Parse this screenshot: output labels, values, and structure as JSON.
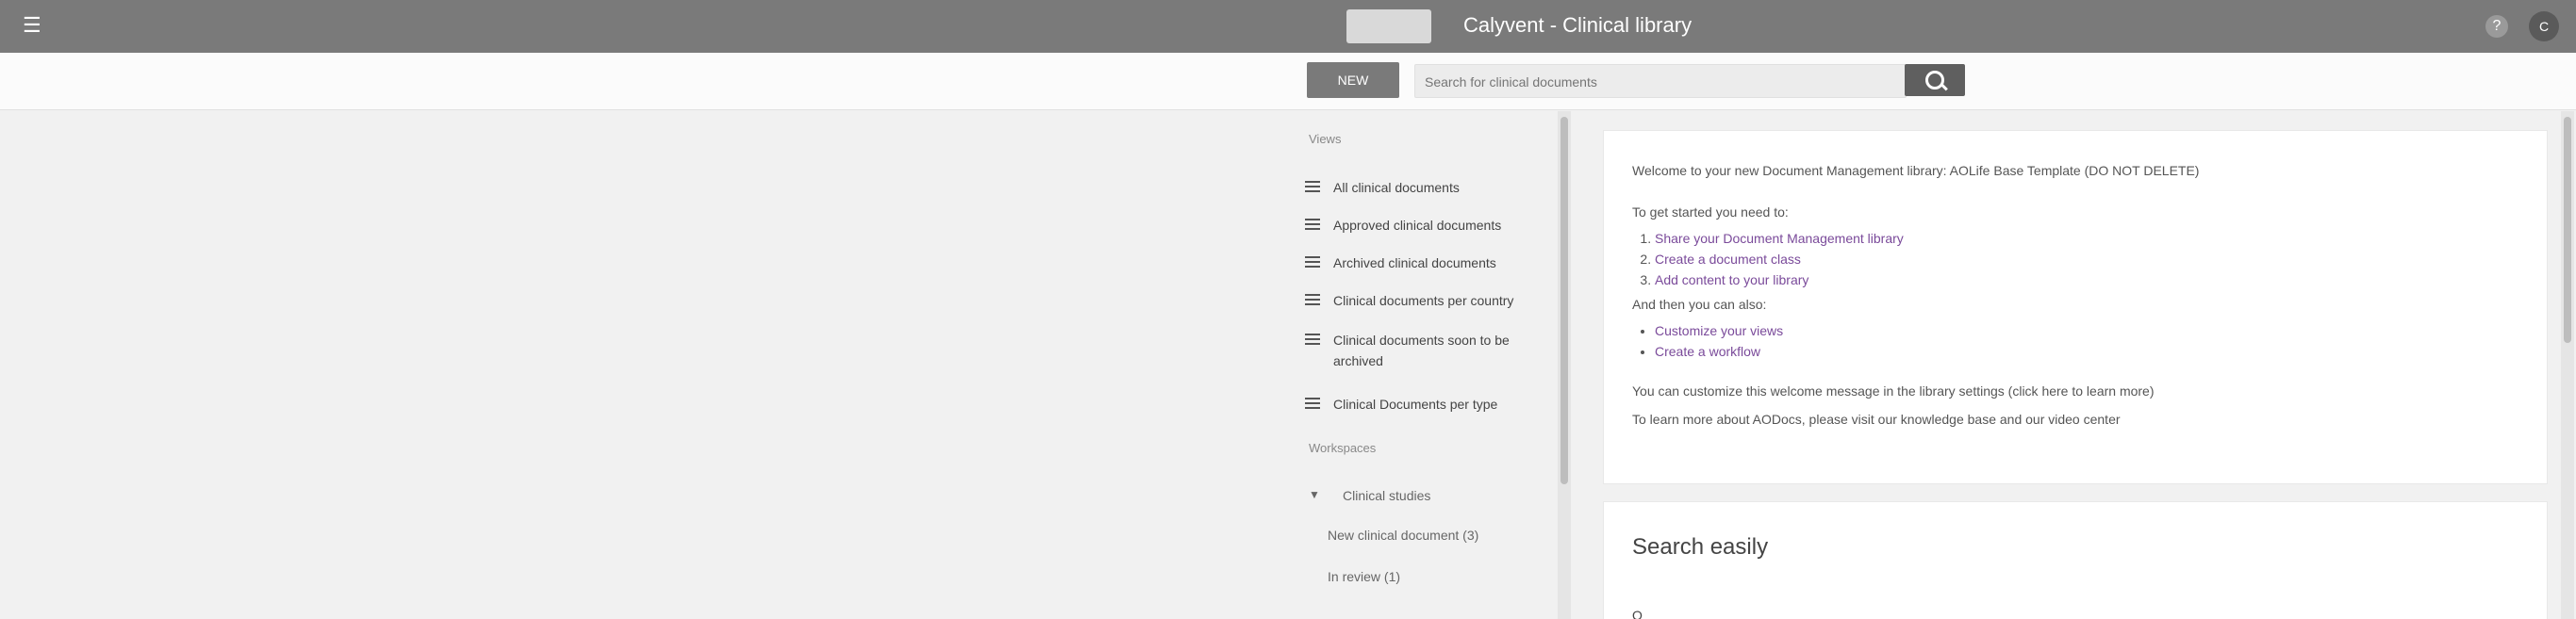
{
  "header": {
    "app_title": "Calyvent - Clinical library",
    "help_icon": "help-circle-icon",
    "avatar_text": "C",
    "menu_icon": "hamburger-icon"
  },
  "toolbar": {
    "new_label": "NEW",
    "search_placeholder": "Search for clinical documents",
    "search_icon": "search-icon"
  },
  "sidebar": {
    "views_label": "Views",
    "views": [
      {
        "label": "All clinical documents"
      },
      {
        "label": "Approved clinical documents"
      },
      {
        "label": "Archived clinical documents"
      },
      {
        "label": "Clinical documents per country"
      },
      {
        "label": "Clinical documents soon to be archived"
      },
      {
        "label": "Clinical Documents per type"
      }
    ],
    "workspaces_label": "Workspaces",
    "workspace_group": "Clinical studies",
    "workspace_items": [
      {
        "label": "New clinical document (3)"
      },
      {
        "label": "In review (1)"
      }
    ]
  },
  "main": {
    "welcome": "Welcome to your new Document Management library: AOLife Base Template (DO NOT DELETE)",
    "get_started": "To get started you need to:",
    "steps": [
      "Share your Document Management library",
      "Create a document class",
      "Add content to your library"
    ],
    "and_then": "And then you can also:",
    "extras": [
      "Customize your views",
      "Create a workflow"
    ],
    "customize_msg": "You can customize this welcome message in the library settings (click here to learn more)",
    "learn_more": "To learn more about AODocs, please visit our knowledge base and our video center",
    "search_heading": "Search easily",
    "search_sub": "Q"
  }
}
